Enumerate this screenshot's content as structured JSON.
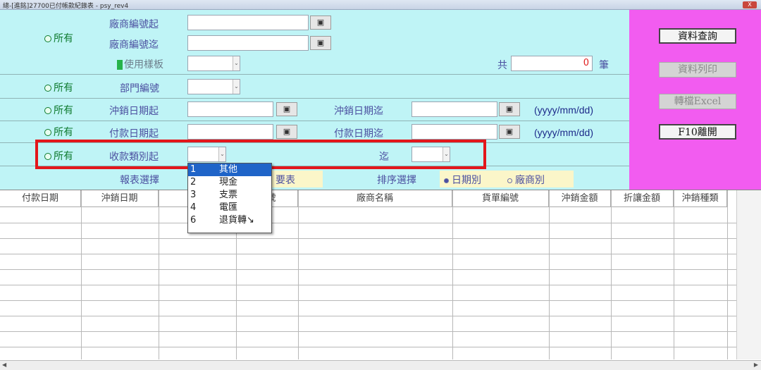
{
  "window": {
    "title": "總-[進銘]27700已付帳款紀錄表 - psy_rev4",
    "close_label": "X"
  },
  "filters": {
    "all_label": "所有",
    "vendor_from": "廠商編號起",
    "vendor_to": "廠商編號迄",
    "use_template": "使用樣板",
    "total_prefix": "共",
    "total_count": "0",
    "total_suffix": "筆",
    "dept_no": "部門編號",
    "writeoff_from": "沖銷日期起",
    "writeoff_to": "沖銷日期迄",
    "pay_from": "付款日期起",
    "pay_to": "付款日期迄",
    "date_format": "(yyyy/mm/dd)",
    "recv_type_from": "收款類別起",
    "recv_type_to": "迄",
    "report_select": "報表選擇",
    "report_summary": "要表",
    "sort_select": "排序選擇",
    "sort_by_date": "日期別",
    "sort_by_vendor": "廠商別"
  },
  "buttons": {
    "query": "資料查詢",
    "print": "資料列印",
    "excel": "轉檔Excel",
    "exit": "F10離開"
  },
  "lookup_icon": "binoculars-icon",
  "dropdown": {
    "options": [
      {
        "code": "1",
        "label": "其他"
      },
      {
        "code": "2",
        "label": "現金"
      },
      {
        "code": "3",
        "label": "支票"
      },
      {
        "code": "4",
        "label": "電匯"
      },
      {
        "code": "6",
        "label": "退貨轉↘"
      }
    ],
    "selected_index": 0
  },
  "table": {
    "columns": [
      "付款日期",
      "沖銷日期",
      "",
      "編號",
      "廠商名稱",
      "貨單編號",
      "沖銷金額",
      "折讓金額",
      "沖銷種類"
    ]
  },
  "colors": {
    "form_bg": "#bff4f6",
    "side_bg": "#f25cf0",
    "highlight": "#e3161b"
  }
}
